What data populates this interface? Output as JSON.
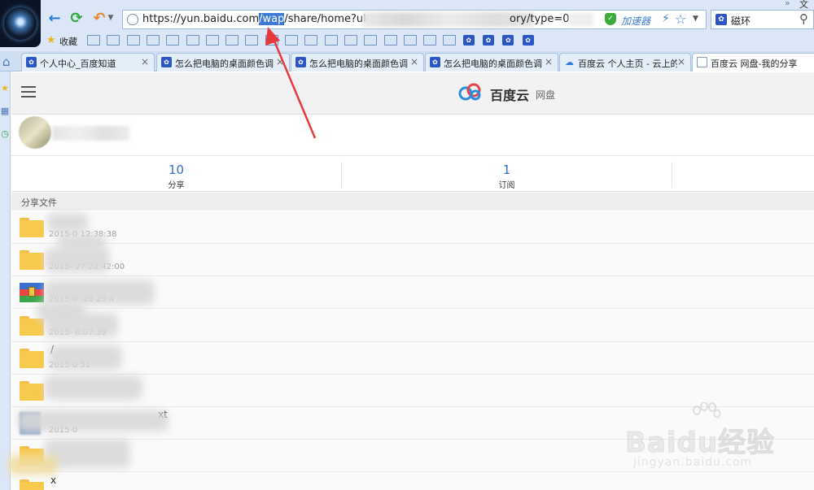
{
  "browser": {
    "url_prefix": "https://yun.baidu.com",
    "url_selected": "/wap",
    "url_after": "/share/home?uk=",
    "url_tail": "ory/type=0",
    "accelerator_label": "加速器",
    "search_text": "磁环",
    "top_right_text": "文",
    "favorites_label": "收藏",
    "favorites_icons": [
      "folder",
      "folder",
      "folder",
      "folder",
      "folder",
      "folder",
      "folder",
      "folder",
      "folder",
      "folder",
      "folder",
      "folder",
      "folder",
      "folder",
      "folder",
      "folder",
      "folder",
      "folder",
      "folder",
      "paw",
      "paw",
      "paw",
      "paw"
    ],
    "tabs": [
      {
        "label": "个人中心_百度知道",
        "icon": "paw",
        "active": false
      },
      {
        "label": "怎么把电脑的桌面颜色调",
        "icon": "paw",
        "active": false
      },
      {
        "label": "怎么把电脑的桌面颜色调",
        "icon": "paw",
        "active": false
      },
      {
        "label": "怎么把电脑的桌面颜色调",
        "icon": "paw",
        "active": false
      },
      {
        "label": "百度云 个人主页 - 云上的",
        "icon": "cloud",
        "active": false
      },
      {
        "label": "百度云 网盘-我的分享",
        "icon": "doc",
        "active": true
      }
    ]
  },
  "app": {
    "logo_text": "百度云",
    "logo_sub": "网盘"
  },
  "stats": [
    {
      "value": "10",
      "label": "分享"
    },
    {
      "value": "1",
      "label": "订阅"
    }
  ],
  "section_title": "分享文件",
  "files": [
    {
      "icon": "folder",
      "name": "",
      "date": "2015-0  12:38:38"
    },
    {
      "icon": "folder",
      "name": "",
      "date": "2015-  27 23:42:00"
    },
    {
      "icon": "archive",
      "name": "",
      "date": "2015-0  -26 23:4"
    },
    {
      "icon": "folder",
      "name": "",
      "date": "2015-  6:07:39"
    },
    {
      "icon": "folder",
      "name": "/",
      "date": "2015-0  51"
    },
    {
      "icon": "folder",
      "name": "",
      "date": ""
    },
    {
      "icon": "doc",
      "name": "xt",
      "date": "2015-0"
    },
    {
      "icon": "folder",
      "name": "",
      "date": ""
    },
    {
      "icon": "folder",
      "name": "x",
      "date": ""
    }
  ],
  "watermark": {
    "main": "Baidu经验",
    "sub": "jingyan.baidu.com"
  },
  "colors": {
    "accent_blue": "#2f6fcb",
    "folder_yellow": "#f7c94c",
    "annotation_red": "#e83a3a",
    "url_selection": "#3d7ad8"
  }
}
